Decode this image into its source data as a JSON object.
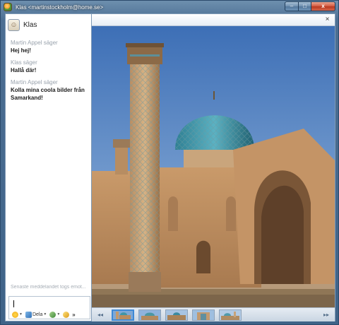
{
  "window": {
    "title": "Klas <martinstockholm@home.se>",
    "controls": {
      "minimize": "–",
      "maximize": "□",
      "close": "x"
    }
  },
  "contact": {
    "name": "Klas",
    "avatar_icon": "contact-avatar-icon"
  },
  "messages": [
    {
      "sender": "Martin Appel säger",
      "text": "Hej hej!"
    },
    {
      "sender": "Klas säger",
      "text": "Hallå där!"
    },
    {
      "sender": "Martin Appel säger",
      "text": "Kolla mina coola bilder från Samarkand!"
    }
  ],
  "status": {
    "last_message": "Senaste meddelandet togs emot..."
  },
  "compose": {
    "value": "",
    "tools": {
      "emoticon_icon": "smiley-icon",
      "share_label": "Dela",
      "share_icon": "share-icon",
      "wink_icon": "wink-icon",
      "nudge_icon": "nudge-icon",
      "more": "»"
    }
  },
  "viewer": {
    "close": "×",
    "prev": "◂◂",
    "next": "▸▸",
    "thumbnail_count": 5,
    "selected_thumbnail": 1
  },
  "colors": {
    "frame": "#4d6f93",
    "accent": "#3d89d6",
    "sender_gray": "#9aa3ad"
  }
}
